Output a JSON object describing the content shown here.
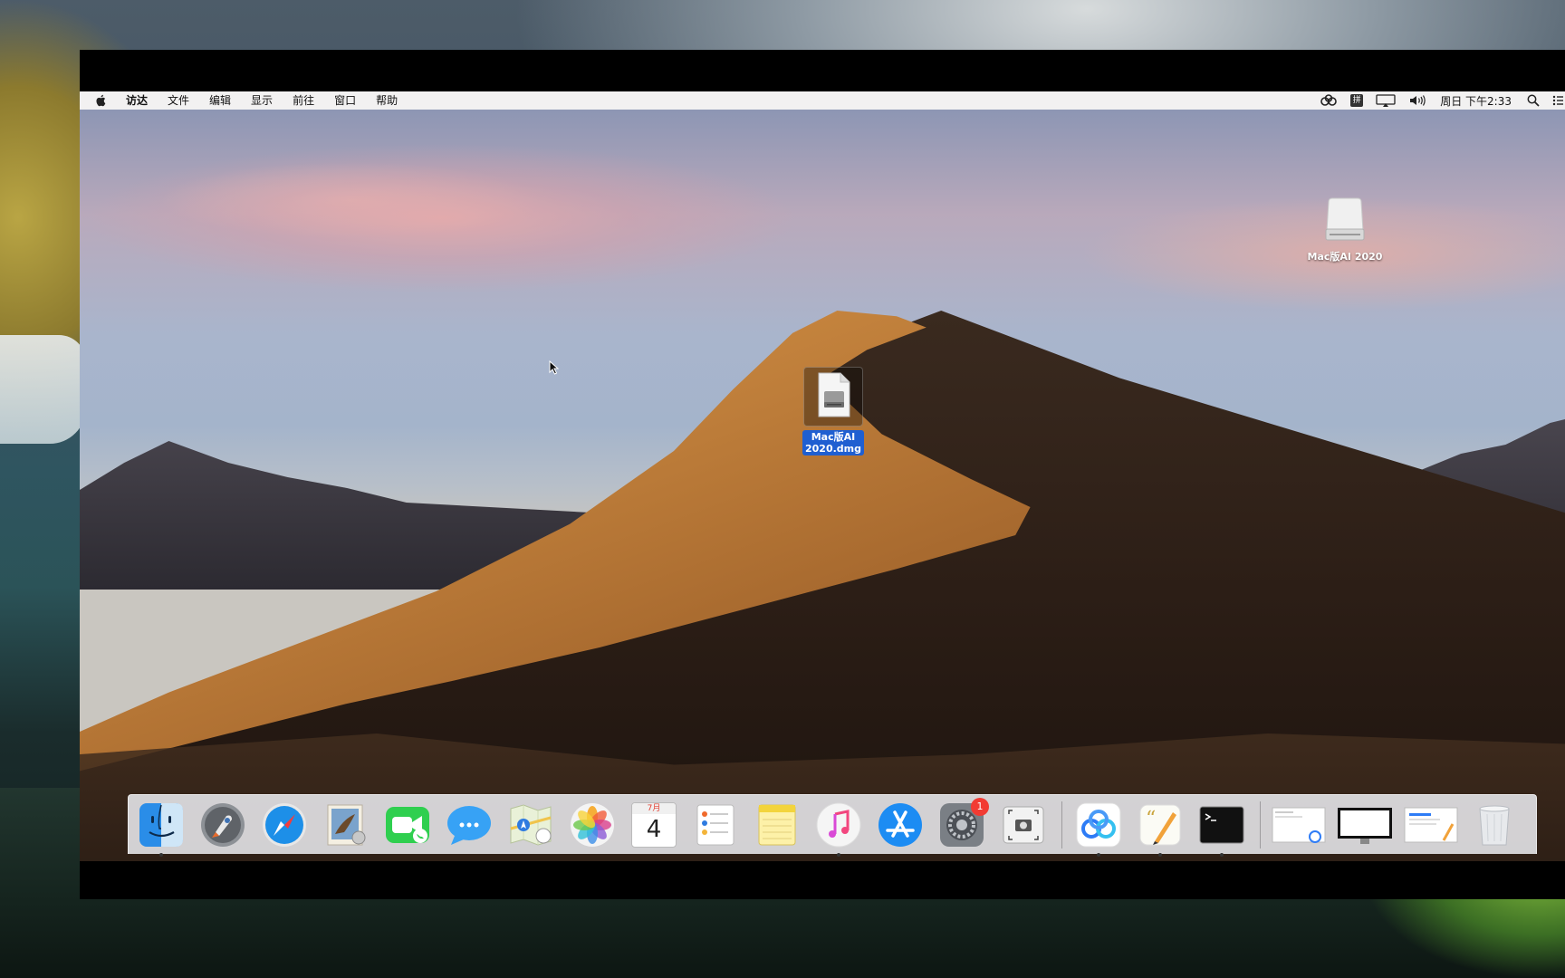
{
  "menubar": {
    "items": [
      "访达",
      "文件",
      "编辑",
      "显示",
      "前往",
      "窗口",
      "帮助"
    ],
    "input_method": "拼",
    "clock": "周日 下午2:33"
  },
  "desktop": {
    "drive_icon_label": "Mac版AI 2020",
    "dmg_icon_label": "Mac版AI\n2020.dmg",
    "dmg_icon_line1": "Mac版AI",
    "dmg_icon_line2": "2020.dmg"
  },
  "dock": {
    "apps": [
      "finder-icon",
      "launchpad-icon",
      "safari-icon",
      "mail-icon",
      "facetime-icon",
      "messages-icon",
      "maps-icon",
      "photos-icon",
      "calendar-icon",
      "reminders-icon",
      "notes-icon",
      "itunes-icon",
      "app-store-icon",
      "system-preferences-icon",
      "screenshot-icon",
      "baidu-netdisk-icon",
      "pages-pen-icon",
      "terminal-icon"
    ],
    "calendar_month": "7月",
    "calendar_day": "4",
    "system_preferences_badge": "1"
  }
}
